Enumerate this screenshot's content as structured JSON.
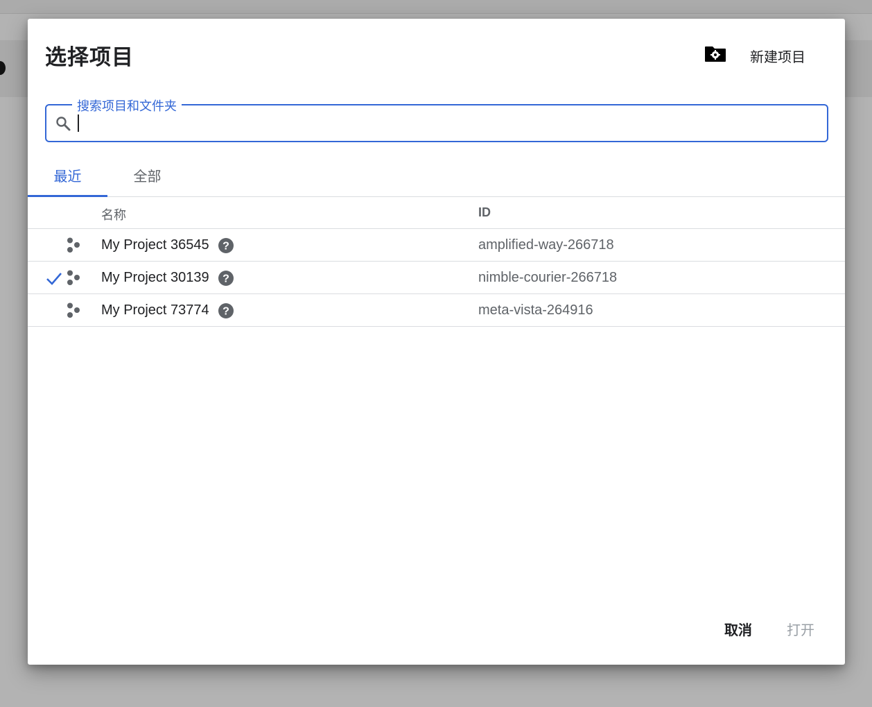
{
  "dialog": {
    "title": "选择项目",
    "new_project_label": "新建项目"
  },
  "search": {
    "label": "搜索项目和文件夹",
    "value": ""
  },
  "tabs": [
    {
      "label": "最近",
      "active": true
    },
    {
      "label": "全部",
      "active": false
    }
  ],
  "table": {
    "headers": {
      "name": "名称",
      "id": "ID"
    },
    "rows": [
      {
        "name": "My Project 36545",
        "id": "amplified-way-266718",
        "selected": false
      },
      {
        "name": "My Project 30139",
        "id": "nimble-courier-266718",
        "selected": true
      },
      {
        "name": "My Project 73774",
        "id": "meta-vista-264916",
        "selected": false
      }
    ]
  },
  "footer": {
    "cancel_label": "取消",
    "open_label": "打开"
  },
  "colors": {
    "accent": "#3367d6",
    "text": "#202124",
    "muted": "#5f6368",
    "disabled": "#9aa0a6",
    "icon": "#5f6368"
  },
  "icons": {
    "new_folder": "folder-gear-icon",
    "search": "search-icon",
    "project": "project-hexagons-icon",
    "help": "help-circle-icon",
    "check": "check-icon"
  }
}
